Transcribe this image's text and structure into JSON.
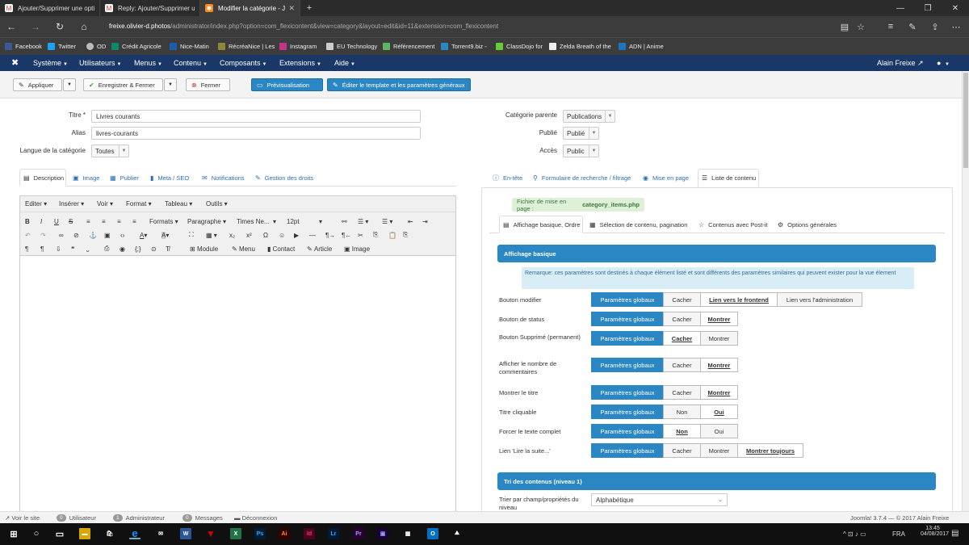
{
  "browser": {
    "tabs": [
      {
        "label": "Ajouter/Supprimer une opti",
        "icon": "gmail-icon"
      },
      {
        "label": "Reply: Ajouter/Supprimer ui",
        "icon": "mail-icon"
      },
      {
        "label": "Modifier la catégorie - J",
        "icon": "joomla-icon",
        "active": true
      }
    ],
    "new_tab": "+",
    "url_domain": "freixe.olivier-d.photos",
    "url_path": "/administrator/index.php?option=com_flexicontent&view=category&layout=edit&id=11&extension=com_flexicontent",
    "favorites": [
      "Facebook",
      "Twitter",
      "OD",
      "Crédit Agricole",
      "Nice-Matin",
      "RécréaNice | Les",
      "Instagram",
      "EU Technology",
      "Référencement",
      "Torrent9.biz -",
      "ClassDojo for",
      "Zelda Breath of the",
      "ADN | Anime"
    ]
  },
  "joomla_menu": {
    "items": [
      "Système",
      "Utilisateurs",
      "Menus",
      "Contenu",
      "Composants",
      "Extensions",
      "Aide"
    ],
    "user": "Alain Freixe"
  },
  "toolbar": {
    "apply": "Appliquer",
    "save_close": "Enregistrer & Fermer",
    "close": "Fermer",
    "preview": "Prévisualisation",
    "edit_template": "Éditer le template et les paramètres généraux"
  },
  "form": {
    "title_label": "Titre *",
    "title_value": "Livres courants",
    "alias_label": "Alias",
    "alias_value": "livres-courants",
    "language_label": "Langue de la catégorie",
    "language_value": "Toutes",
    "parent_label": "Catégorie parente",
    "parent_value": "Publications",
    "published_label": "Publié",
    "published_value": "Publié",
    "access_label": "Accès",
    "access_value": "Public"
  },
  "left_tabs": [
    "Description",
    "Image",
    "Publier",
    "Meta / SEO",
    "Notifications",
    "Gestion des droits"
  ],
  "editor": {
    "menu": [
      "Editer",
      "Insérer",
      "Voir",
      "Format",
      "Tableau",
      "Outils"
    ],
    "formats": "Formats",
    "paragraph": "Paragraphe",
    "font": "Times Ne...",
    "size": "12pt",
    "buttons": [
      "Module",
      "Menu",
      "Contact",
      "Article",
      "Image"
    ]
  },
  "right_tabs": [
    "En-tête",
    "Formulaire de recherche / filtrage",
    "Mise en page",
    "Liste de contenu"
  ],
  "layout_note": {
    "label": "Fichier de mise en page :",
    "value": "category_items.php"
  },
  "sub_tabs": [
    "Affichage basique, Ordre",
    "Sélection de contenu, pagination",
    "Contenus avec Post-it",
    "Options générales"
  ],
  "section1": {
    "title": "Affichage basique",
    "remark": "Remarque: ces paramètres sont destinés à chaque élément listé et sont différents des paramètres similaires qui peuvent exister pour la vue élement",
    "rows": [
      {
        "label": "Bouton modifier",
        "options": [
          "Paramètres globaux",
          "Cacher",
          "Lien vers le frontend",
          "Lien vers l'administration"
        ],
        "selected": 2
      },
      {
        "label": "Bouton de status",
        "options": [
          "Paramètres globaux",
          "Cacher",
          "Montrer"
        ],
        "selected": 2
      },
      {
        "label": "Bouton Supprimé (permanent)",
        "options": [
          "Paramètres globaux",
          "Cacher",
          "Montrer"
        ],
        "selected": 1
      },
      {
        "label": "Afficher le nombre de commentaires",
        "options": [
          "Paramètres globaux",
          "Cacher",
          "Montrer"
        ],
        "selected": 2
      },
      {
        "label": "Montrer le titre",
        "options": [
          "Paramètres globaux",
          "Cacher",
          "Montrer"
        ],
        "selected": 2
      },
      {
        "label": "Titre cliquable",
        "options": [
          "Paramètres globaux",
          "Non",
          "Oui"
        ],
        "selected": 2
      },
      {
        "label": "Forcer le texte complet",
        "options": [
          "Paramètres globaux",
          "Non",
          "Oui"
        ],
        "selected": 1
      },
      {
        "label": "Lien 'Lire la suite...'",
        "options": [
          "Paramètres globaux",
          "Cacher",
          "Montrer",
          "Montrer toujours"
        ],
        "selected": 3
      }
    ]
  },
  "section2": {
    "title": "Tri des contenus (niveau 1)",
    "sort_label": "Trier par champ/propriétés du niveau",
    "sort_value": "Alphabétique"
  },
  "status": {
    "view_site": "Voir le site",
    "users_count": "0",
    "users": "Utilisateur",
    "admin_count": "1",
    "admin": "Administrateur",
    "msg_count": "0",
    "messages": "Messages",
    "logout": "Déconnexion",
    "version": "Joomla! 3.7.4 — © 2017 Alain Freixe"
  },
  "taskbar": {
    "lang": "FRA",
    "time": "13:45",
    "date": "04/08/2017"
  },
  "colors": {
    "joomla_nav": "#1a3867",
    "primary": "#2a87c4",
    "success_note": "#dff0d8"
  }
}
